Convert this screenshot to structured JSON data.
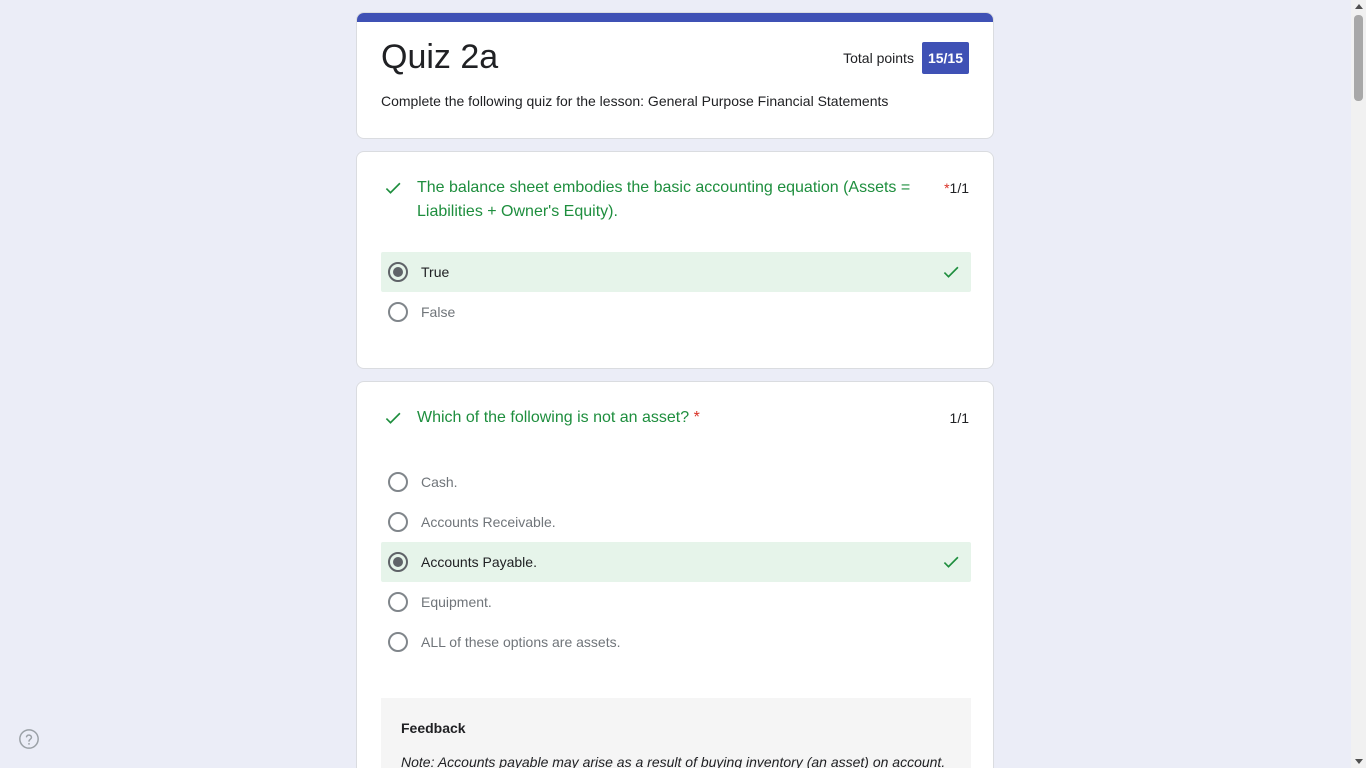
{
  "header": {
    "title": "Quiz 2a",
    "points_label": "Total points",
    "points_value": "15/15",
    "description": "Complete the following quiz for the lesson: General Purpose Financial Statements"
  },
  "questions": [
    {
      "text": "The balance sheet embodies the basic accounting equation (Assets = Liabilities + Owner's Equity).",
      "required_marker": "*",
      "score": "1/1",
      "options": [
        "True",
        "False"
      ]
    },
    {
      "text": "Which of the following is not an asset?",
      "required_marker": "*",
      "score": "1/1",
      "options": [
        "Cash.",
        "Accounts Receivable.",
        "Accounts Payable.",
        "Equipment.",
        "ALL of these options are assets."
      ],
      "feedback_title": "Feedback",
      "feedback_note": "Note: Accounts payable may arise as a result of buying inventory (an asset) on account."
    }
  ],
  "colors": {
    "accent": "#3f51b5",
    "correct": "#1e8e3e",
    "correct_bg": "#e6f4ea",
    "required": "#d93025",
    "page_bg": "#ebedf7"
  },
  "icons": {
    "correct": "check-icon",
    "help": "help-icon"
  }
}
